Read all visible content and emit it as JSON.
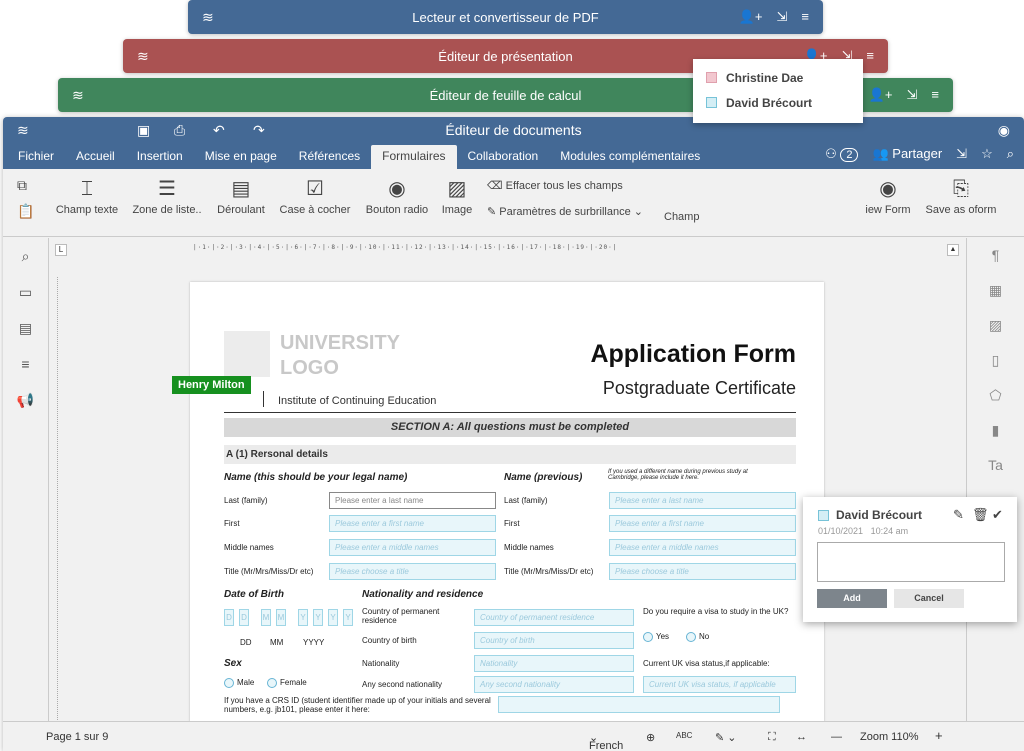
{
  "windows": {
    "pdf": "Lecteur et convertisseur de PDF",
    "presentation": "Éditeur de présentation",
    "spreadsheet": "Éditeur de feuille de calcul",
    "document": "Éditeur de documents"
  },
  "menu": [
    "Fichier",
    "Accueil",
    "Insertion",
    "Mise en page",
    "Références",
    "Formulaires",
    "Collaboration",
    "Modules complémentaires"
  ],
  "header": {
    "users_count": "2",
    "share": "Partager"
  },
  "ribbon": {
    "text_field": "Champ texte",
    "list_box": "Zone de liste..",
    "dropdown": "Déroulant",
    "checkbox": "Case à cocher",
    "radio": "Bouton radio",
    "image": "Image",
    "clear_all": "Effacer tous les champs",
    "highlight": "Paramètres de surbrillance",
    "champ": "Champ",
    "view_form": "iew Form",
    "save_oform": "Save as oform"
  },
  "users": [
    "Christine Dae",
    "David Brécourt"
  ],
  "form": {
    "logo1": "UNIVERSITY",
    "logo2": "LOGO",
    "institute": "Institute of Continuing Education",
    "title": "Application Form",
    "subtitle": "Postgraduate Certificate",
    "section": "SECTION A: All questions must be completed",
    "personal": "A (1) Rersonal details",
    "name_legal": "Name (this should be your legal name)",
    "name_prev": "Name (previous)",
    "name_prev_note": "If you used a different name during previous study at Cambridge, please include it here.",
    "last": "Last (family)",
    "first": "First",
    "middle": "Middle names",
    "title_lbl": "Title (Mr/Mrs/Miss/Dr etc)",
    "ph_last": "Please enter a last name",
    "ph_first": "Please enter a first name",
    "ph_middle": "Please enter a middle names",
    "ph_title": "Please choose a title",
    "dob": "Date of Birth",
    "nationality_res": "Nationality and residence",
    "dob_digits": [
      "D",
      "D",
      "M",
      "M",
      "Y",
      "Y",
      "Y",
      "Y"
    ],
    "dd": "DD",
    "mm": "MM",
    "yyyy": "YYYY",
    "country_res": "Country of permanent residence",
    "country_birth": "Country of birth",
    "nationality": "Nationality",
    "any_second": "Any second nationality",
    "ph_country_res": "Country of permanent residence",
    "ph_country_birth": "Country of birth",
    "ph_nationality": "Nationality",
    "ph_second": "Any second nationality",
    "visa_q": "Do you require a visa to study in the UK?",
    "yes": "Yes",
    "no": "No",
    "visa_status": "Current UK visa status,if applicable:",
    "ph_visa": "Current UK visa status, if applicable",
    "sex": "Sex",
    "male": "Male",
    "female": "Female",
    "crs": "If you have a CRS ID (student identifier made up of your initials and several numbers, e.g. jb101, please enter it here:"
  },
  "collab_tag": "Henry Milton",
  "comment": {
    "author": "David Brécourt",
    "date": "01/10/2021",
    "time": "10:24 am",
    "add": "Add",
    "cancel": "Cancel"
  },
  "status": {
    "page": "Page 1 sur 9",
    "lang": "French",
    "zoom": "Zoom 110%"
  },
  "colors": {
    "pdf": "#446995",
    "presentation": "#aa5252",
    "spreadsheet": "#40865c",
    "document": "#446995",
    "field_fill": "#e8f6fa"
  }
}
